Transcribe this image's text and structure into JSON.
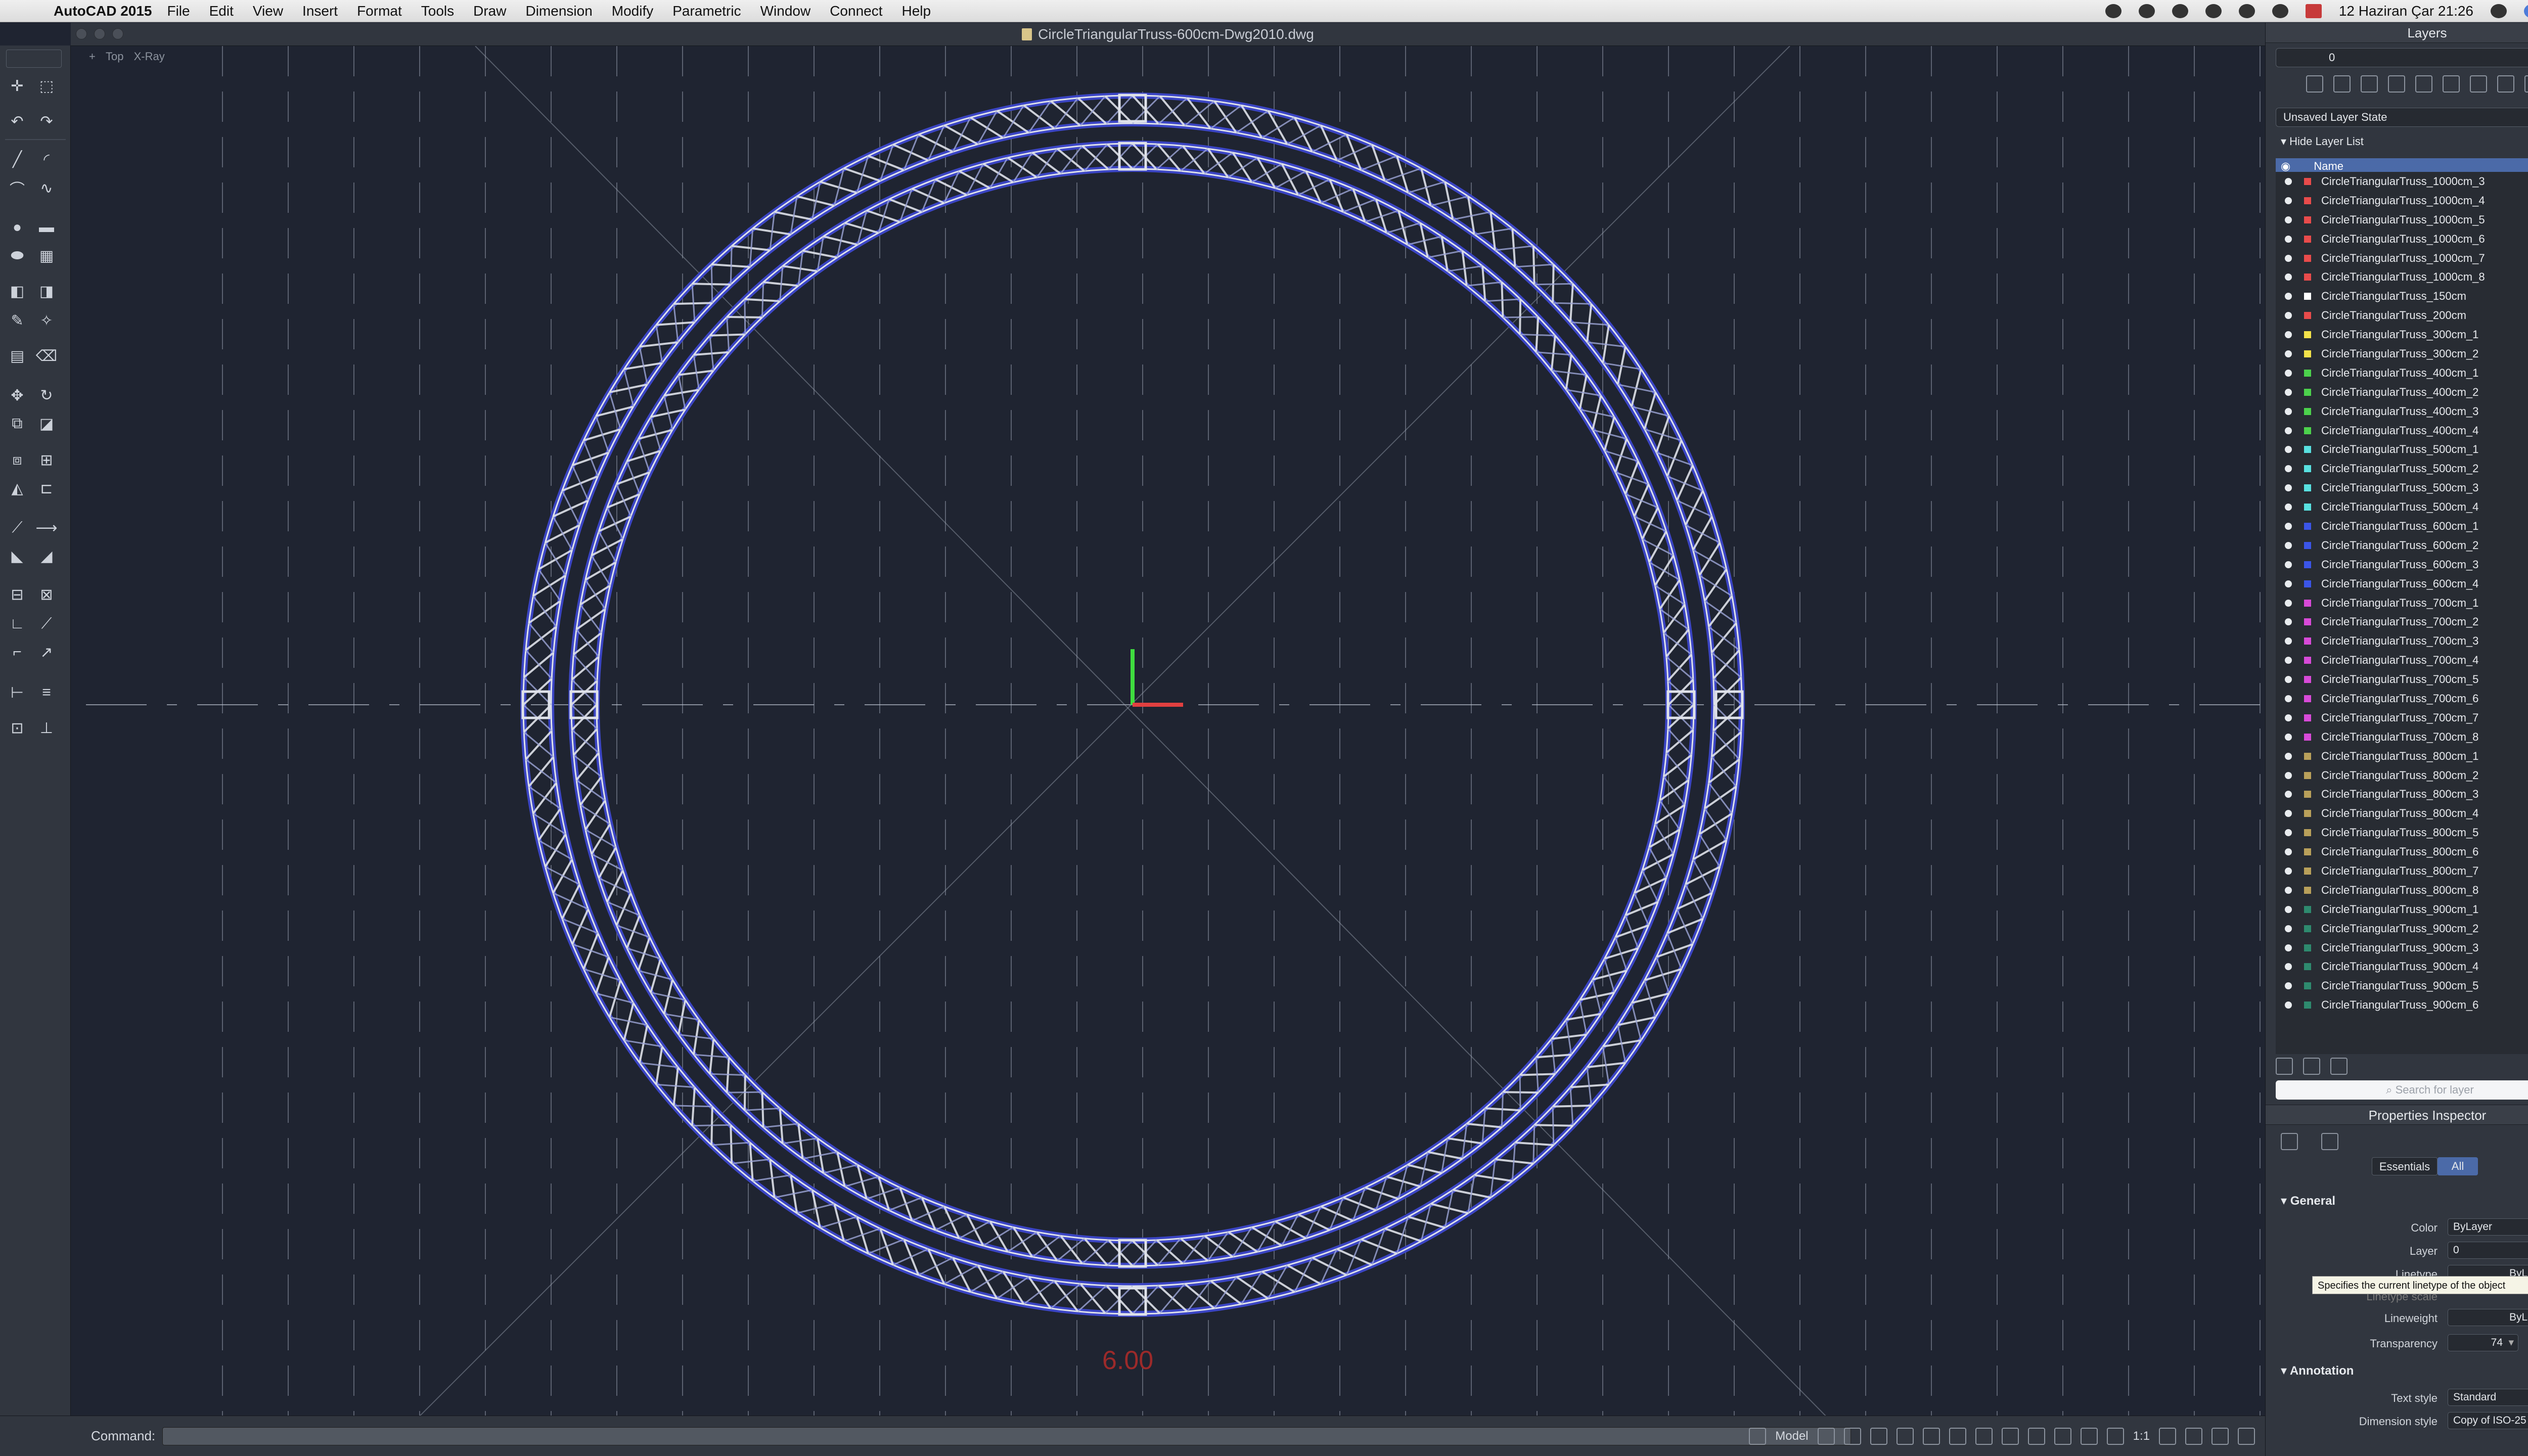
{
  "menubar": {
    "app_name": "AutoCAD 2015",
    "items": [
      "File",
      "Edit",
      "View",
      "Insert",
      "Format",
      "Tools",
      "Draw",
      "Dimension",
      "Modify",
      "Parametric",
      "Window",
      "Connect",
      "Help"
    ],
    "clock": "12 Haziran Çar  21:26"
  },
  "window": {
    "title": "CircleTriangularTruss-600cm-Dwg2010.dwg"
  },
  "viewport": {
    "view_name": "Top",
    "visual_style": "X-Ray",
    "scale_text": "6.00"
  },
  "command": {
    "label": "Command:",
    "value": ""
  },
  "status": {
    "model": "Model",
    "scale": "1:1"
  },
  "layers_panel": {
    "title": "Layers",
    "current_layer": "0",
    "layer_state": "Unsaved Layer State",
    "hide_toggle": "Hide Layer List",
    "column_name": "Name",
    "search_placeholder": "Search for layer",
    "layers": [
      {
        "name": "CircleTriangularTruss_1000cm_3",
        "color": "#e94b4b"
      },
      {
        "name": "CircleTriangularTruss_1000cm_4",
        "color": "#e94b4b"
      },
      {
        "name": "CircleTriangularTruss_1000cm_5",
        "color": "#e94b4b"
      },
      {
        "name": "CircleTriangularTruss_1000cm_6",
        "color": "#e94b4b"
      },
      {
        "name": "CircleTriangularTruss_1000cm_7",
        "color": "#e94b4b"
      },
      {
        "name": "CircleTriangularTruss_1000cm_8",
        "color": "#e94b4b"
      },
      {
        "name": "CircleTriangularTruss_150cm",
        "color": "#ffffff"
      },
      {
        "name": "CircleTriangularTruss_200cm",
        "color": "#e94b4b"
      },
      {
        "name": "CircleTriangularTruss_300cm_1",
        "color": "#f3e24a"
      },
      {
        "name": "CircleTriangularTruss_300cm_2",
        "color": "#f3e24a"
      },
      {
        "name": "CircleTriangularTruss_400cm_1",
        "color": "#4cd24c"
      },
      {
        "name": "CircleTriangularTruss_400cm_2",
        "color": "#4cd24c"
      },
      {
        "name": "CircleTriangularTruss_400cm_3",
        "color": "#4cd24c"
      },
      {
        "name": "CircleTriangularTruss_400cm_4",
        "color": "#4cd24c"
      },
      {
        "name": "CircleTriangularTruss_500cm_1",
        "color": "#58e0e0"
      },
      {
        "name": "CircleTriangularTruss_500cm_2",
        "color": "#58e0e0"
      },
      {
        "name": "CircleTriangularTruss_500cm_3",
        "color": "#58e0e0"
      },
      {
        "name": "CircleTriangularTruss_500cm_4",
        "color": "#58e0e0"
      },
      {
        "name": "CircleTriangularTruss_600cm_1",
        "color": "#3b55e8"
      },
      {
        "name": "CircleTriangularTruss_600cm_2",
        "color": "#3b55e8"
      },
      {
        "name": "CircleTriangularTruss_600cm_3",
        "color": "#3b55e8"
      },
      {
        "name": "CircleTriangularTruss_600cm_4",
        "color": "#3b55e8"
      },
      {
        "name": "CircleTriangularTruss_700cm_1",
        "color": "#d84ad8"
      },
      {
        "name": "CircleTriangularTruss_700cm_2",
        "color": "#d84ad8"
      },
      {
        "name": "CircleTriangularTruss_700cm_3",
        "color": "#d84ad8"
      },
      {
        "name": "CircleTriangularTruss_700cm_4",
        "color": "#d84ad8"
      },
      {
        "name": "CircleTriangularTruss_700cm_5",
        "color": "#d84ad8"
      },
      {
        "name": "CircleTriangularTruss_700cm_6",
        "color": "#d84ad8"
      },
      {
        "name": "CircleTriangularTruss_700cm_7",
        "color": "#d84ad8"
      },
      {
        "name": "CircleTriangularTruss_700cm_8",
        "color": "#d84ad8"
      },
      {
        "name": "CircleTriangularTruss_800cm_1",
        "color": "#b9a05a"
      },
      {
        "name": "CircleTriangularTruss_800cm_2",
        "color": "#b9a05a"
      },
      {
        "name": "CircleTriangularTruss_800cm_3",
        "color": "#b9a05a"
      },
      {
        "name": "CircleTriangularTruss_800cm_4",
        "color": "#b9a05a"
      },
      {
        "name": "CircleTriangularTruss_800cm_5",
        "color": "#b9a05a"
      },
      {
        "name": "CircleTriangularTruss_800cm_6",
        "color": "#b9a05a"
      },
      {
        "name": "CircleTriangularTruss_800cm_7",
        "color": "#b9a05a"
      },
      {
        "name": "CircleTriangularTruss_800cm_8",
        "color": "#b9a05a"
      },
      {
        "name": "CircleTriangularTruss_900cm_1",
        "color": "#2e8a6e"
      },
      {
        "name": "CircleTriangularTruss_900cm_2",
        "color": "#2e8a6e"
      },
      {
        "name": "CircleTriangularTruss_900cm_3",
        "color": "#2e8a6e"
      },
      {
        "name": "CircleTriangularTruss_900cm_4",
        "color": "#2e8a6e"
      },
      {
        "name": "CircleTriangularTruss_900cm_5",
        "color": "#2e8a6e"
      },
      {
        "name": "CircleTriangularTruss_900cm_6",
        "color": "#2e8a6e"
      }
    ]
  },
  "properties": {
    "title": "Properties Inspector",
    "tab_essentials": "Essentials",
    "tab_all": "All",
    "general_title": "General",
    "color_label": "Color",
    "color_value": "ByLayer",
    "layer_label": "Layer",
    "layer_value": "0",
    "linetype_label": "Linetype",
    "linetype_value": "ByLayer",
    "linetype_scale_label": "Linetype scale",
    "lineweight_label": "Lineweight",
    "lineweight_value": "ByLayer",
    "transparency_label": "Transparency",
    "transparency_value": "74",
    "tooltip": "Specifies the current linetype of the object",
    "annotation_title": "Annotation",
    "text_style_label": "Text style",
    "text_style_value": "Standard",
    "dim_style_label": "Dimension style",
    "dim_style_value": "Copy of ISO-25"
  },
  "colors": {
    "canvas_bg": "#1f2431",
    "truss_blue": "#3b45c4",
    "truss_white": "#dfe2ea",
    "axis_green": "#3fdc3f",
    "axis_red": "#e24040"
  }
}
